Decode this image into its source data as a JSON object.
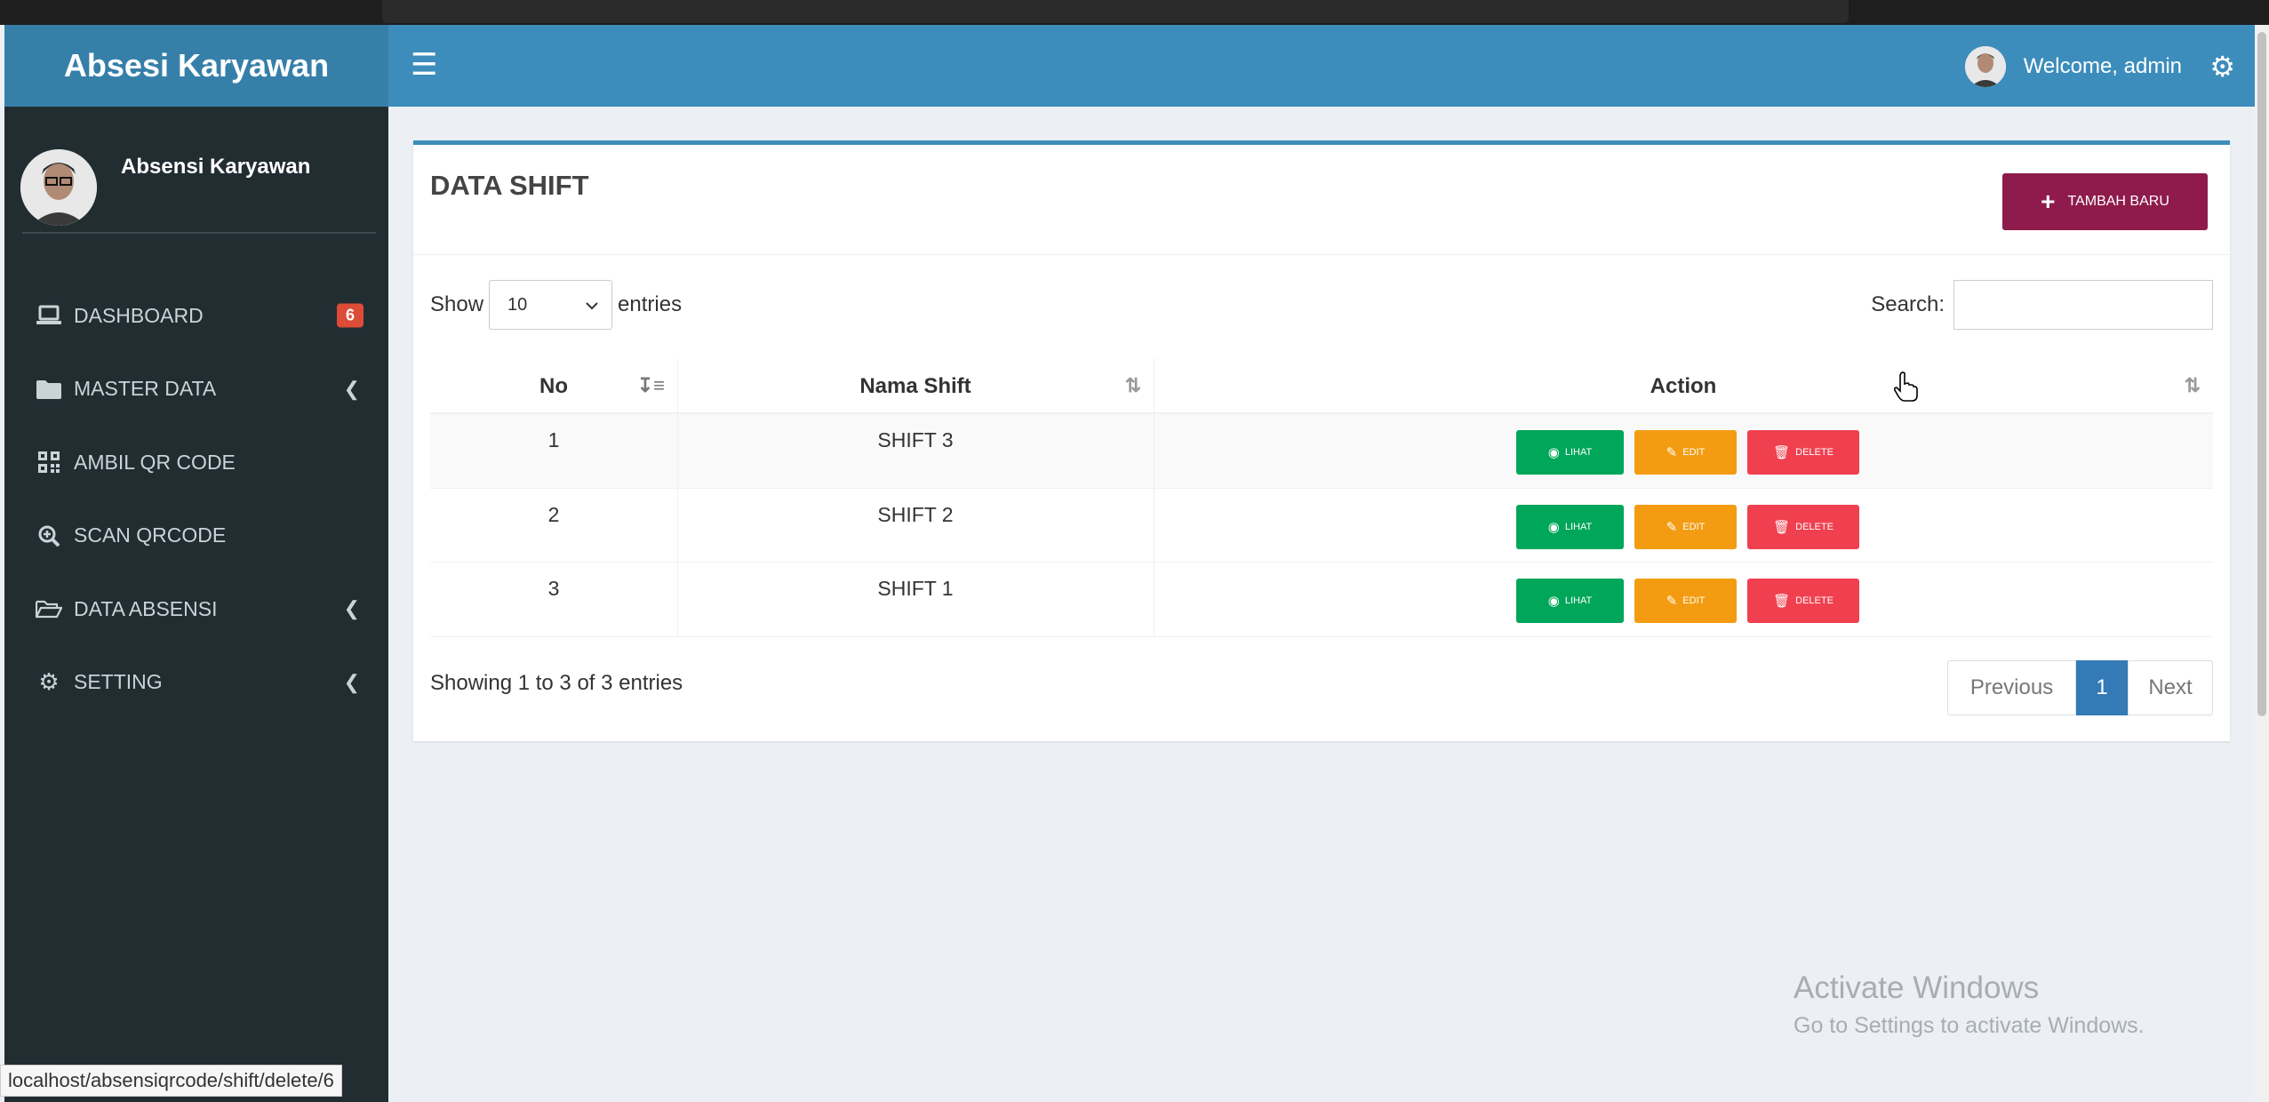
{
  "app": {
    "title": "Absesi Karyawan"
  },
  "sidebar": {
    "user_name": "Absensi Karyawan",
    "items": [
      {
        "label": "DASHBOARD",
        "icon": "laptop-icon",
        "badge": "6"
      },
      {
        "label": "MASTER DATA",
        "icon": "folder-icon"
      },
      {
        "label": "AMBIL QR CODE",
        "icon": "qrcode-icon"
      },
      {
        "label": "SCAN QRCODE",
        "icon": "search-plus-icon"
      },
      {
        "label": "DATA ABSENSI",
        "icon": "folder-open-icon"
      },
      {
        "label": "SETTING",
        "icon": "cogs-icon"
      }
    ]
  },
  "header": {
    "welcome": "Welcome, admin"
  },
  "box": {
    "title": "DATA SHIFT",
    "new_button": "TAMBAH BARU",
    "show_label": "Show",
    "entries_value": "10",
    "entries_label": "entries",
    "search_label": "Search:",
    "columns": [
      "No",
      "Nama Shift",
      "Action"
    ],
    "rows": [
      {
        "no": "1",
        "name": "SHIFT 3"
      },
      {
        "no": "2",
        "name": "SHIFT 2"
      },
      {
        "no": "3",
        "name": "SHIFT 1"
      }
    ],
    "action_labels": {
      "view": "LIHAT",
      "edit": "EDIT",
      "delete": "DELETE"
    },
    "showing": "Showing 1 to 3 of 3 entries",
    "pagination": {
      "previous": "Previous",
      "current": "1",
      "next": "Next"
    }
  },
  "watermark": {
    "line1": "Activate Windows",
    "line2": "Go to Settings to activate Windows."
  },
  "status_url": "localhost/absensiqrcode/shift/delete/6",
  "colors": {
    "sidebar": "#222d32",
    "header": "#3c8dbc",
    "new_button": "#8e1b4c",
    "view": "#00a65a",
    "edit": "#f39c12",
    "delete": "#f0404f"
  }
}
